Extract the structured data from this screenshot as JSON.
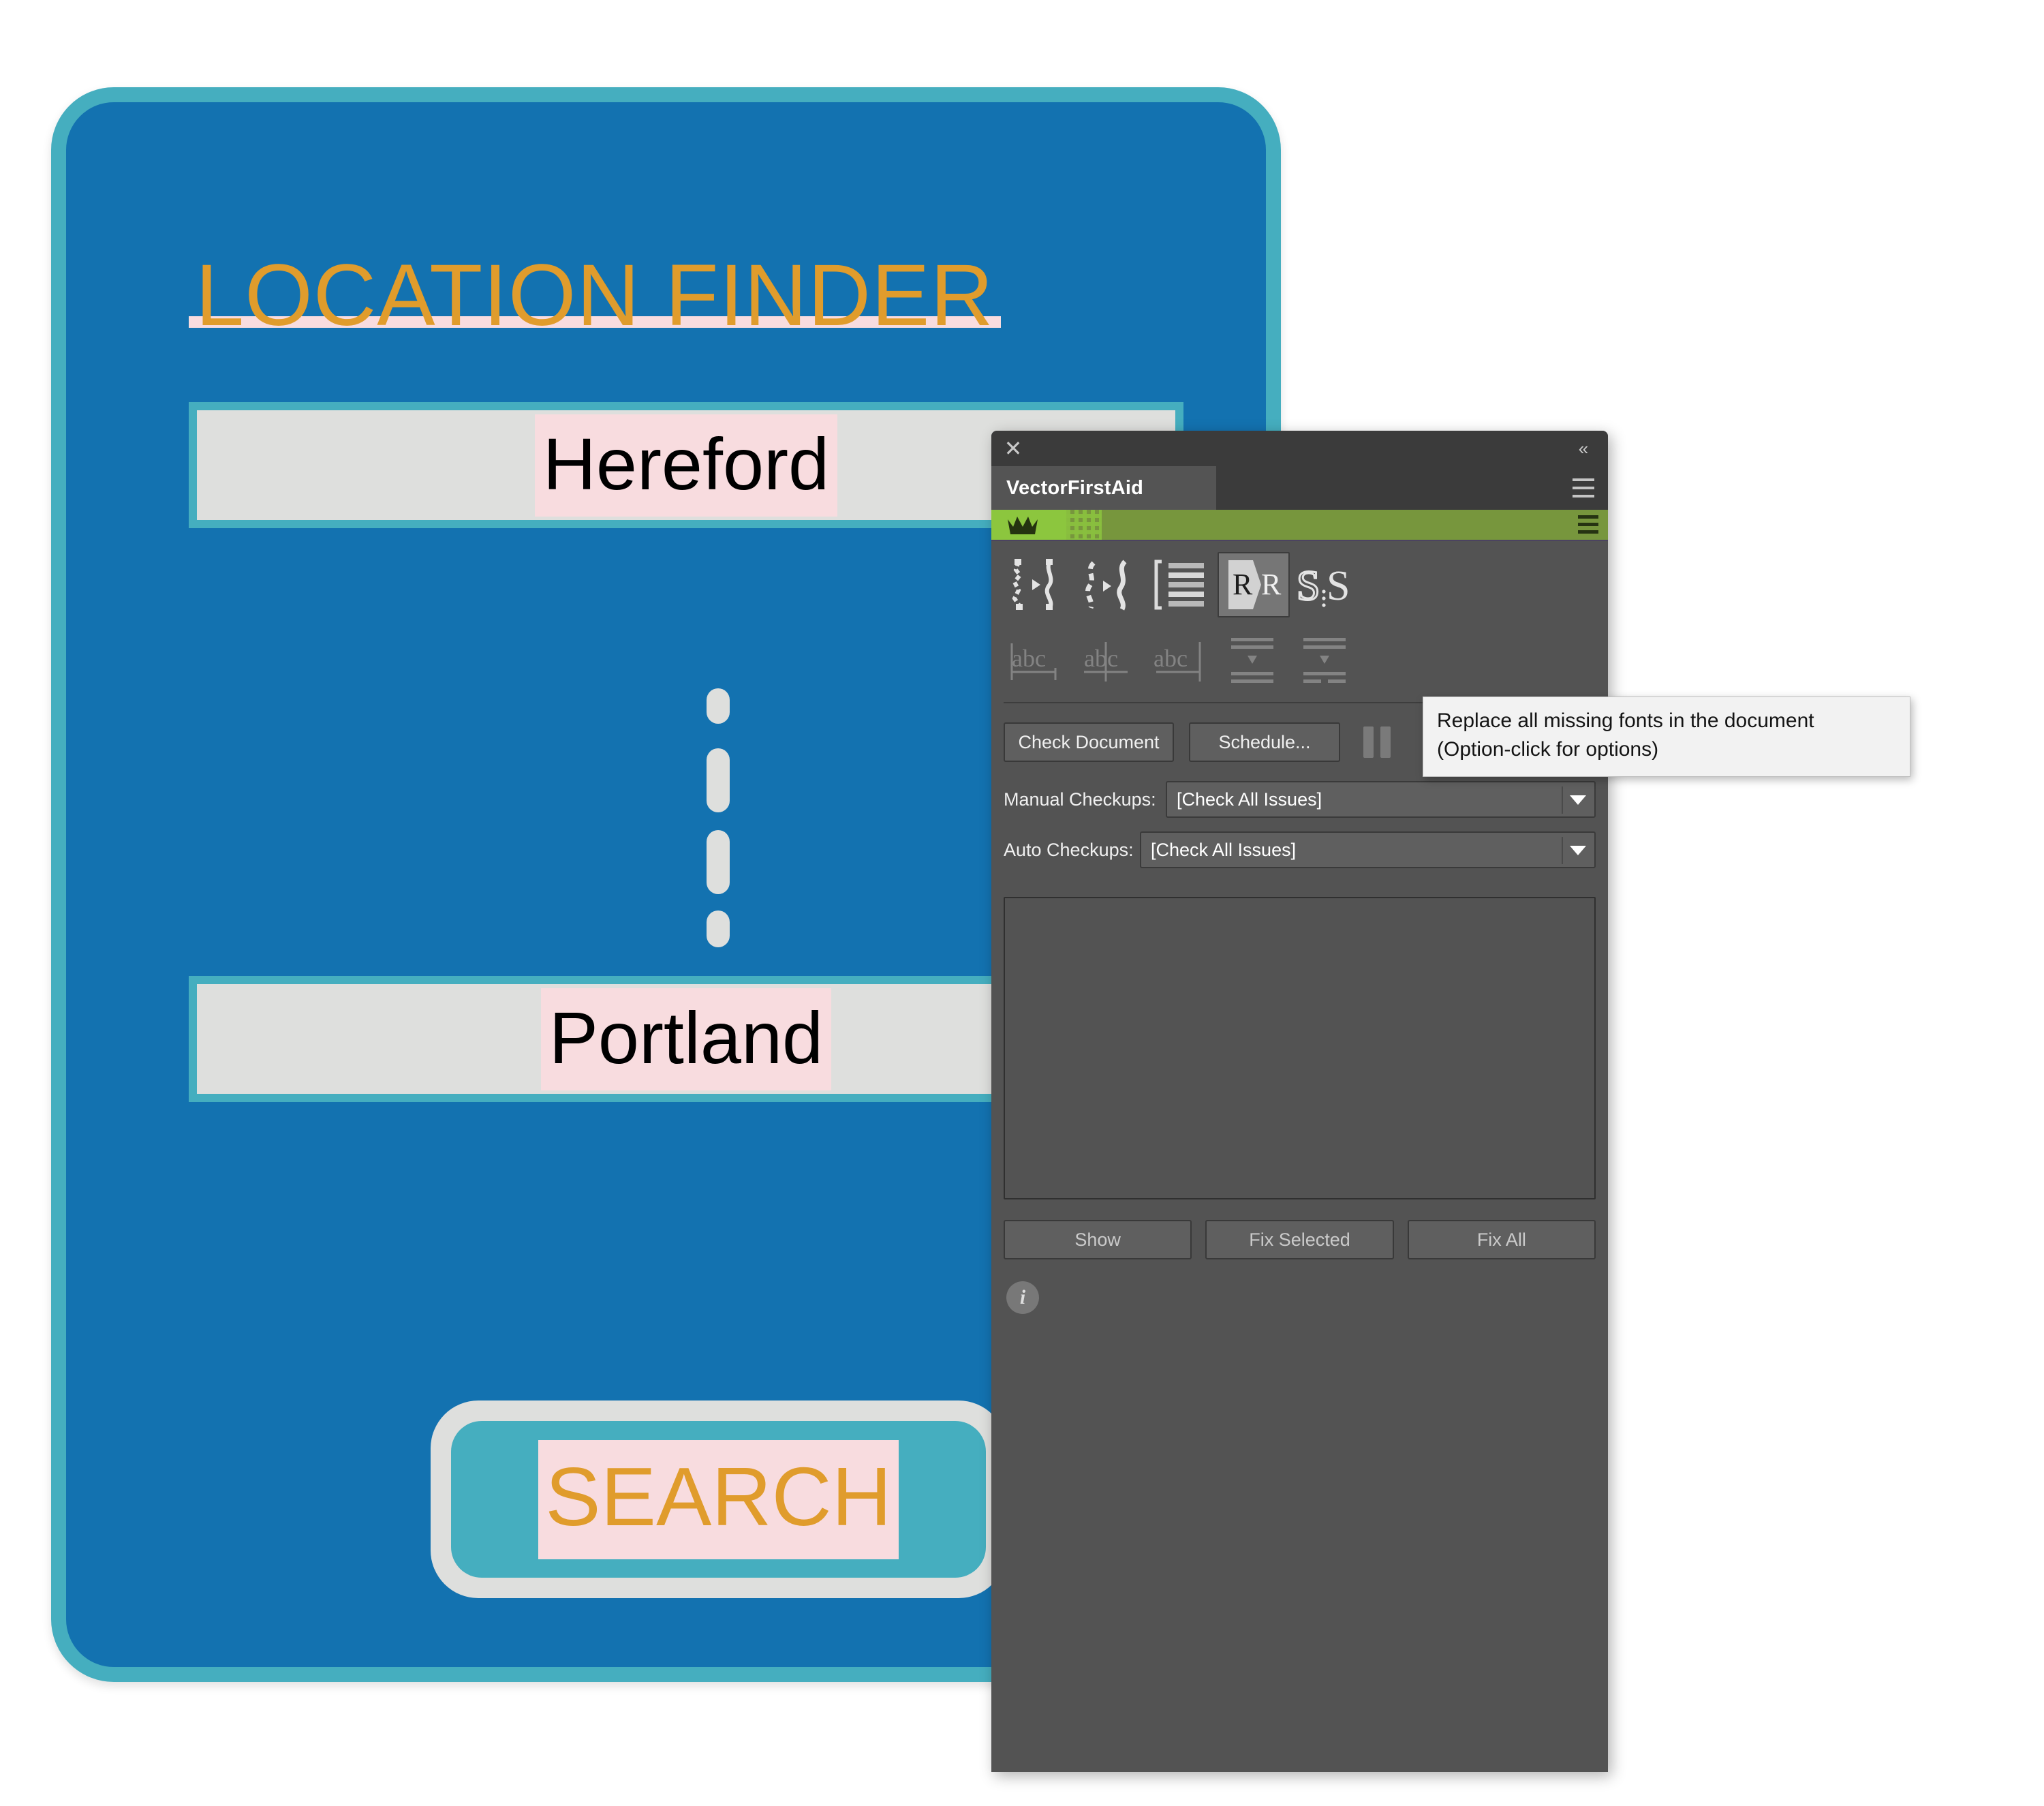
{
  "mockup": {
    "title": "LOCATION FINDER",
    "origin_value": "Hereford",
    "destination_value": "Portland",
    "search_label": "SEARCH",
    "colors": {
      "card_fill": "#1372b0",
      "card_border": "#45aebf",
      "field_fill": "#dedfdd",
      "accent_text": "#e09c2c",
      "missing_font_highlight": "#f8dcdf"
    }
  },
  "panel": {
    "titlebar": {
      "close_icon": "close-icon",
      "collapse_icon": "double-chevron-left-icon"
    },
    "tab_label": "VectorFirstAid",
    "menu_icon": "hamburger-menu-icon",
    "promo": {
      "crown_icon": "crown-icon",
      "menu_icon": "hamburger-menu-icon",
      "green_bright": "#8cc63e",
      "green_dark": "#77963d"
    },
    "toolbar_row_1": [
      {
        "name": "smooth-path-icon",
        "label": "Smooth Path",
        "active": false,
        "disabled": false
      },
      {
        "name": "simplify-path-icon",
        "label": "Simplify Path",
        "active": false,
        "disabled": false
      },
      {
        "name": "text-frame-icon",
        "label": "Text Frame",
        "active": false,
        "disabled": false
      },
      {
        "name": "replace-missing-fonts-icon",
        "label": "Replace Missing Fonts",
        "active": true,
        "disabled": false
      },
      {
        "name": "outline-strokes-icon",
        "label": "Outline Strokes",
        "active": false,
        "disabled": false
      }
    ],
    "toolbar_row_2": [
      {
        "name": "text-align-left-icon",
        "label": "Align Text Left",
        "disabled": true
      },
      {
        "name": "text-align-center-icon",
        "label": "Align Text Center",
        "disabled": true
      },
      {
        "name": "text-align-right-icon",
        "label": "Align Text Right",
        "disabled": true
      },
      {
        "name": "paragraph-spacing-icon",
        "label": "Paragraph Spacing",
        "disabled": true
      },
      {
        "name": "paragraph-spacing-uneven-icon",
        "label": "Paragraph Spacing Uneven",
        "disabled": true
      }
    ],
    "actions": {
      "check_document": "Check Document",
      "schedule": "Schedule...",
      "pause_icon": "pause-icon"
    },
    "selects": [
      {
        "label": "Manual Checkups:",
        "value": "[Check All Issues]"
      },
      {
        "label": "Auto Checkups:",
        "value": "[Check All Issues]"
      }
    ],
    "bottom_buttons": [
      {
        "label": "Show"
      },
      {
        "label": "Fix Selected"
      },
      {
        "label": "Fix All"
      }
    ],
    "info_icon": "info-icon",
    "info_glyph": "i"
  },
  "tooltip": {
    "line1": "Replace all missing fonts in the document",
    "line2": "(Option-click for options)"
  }
}
